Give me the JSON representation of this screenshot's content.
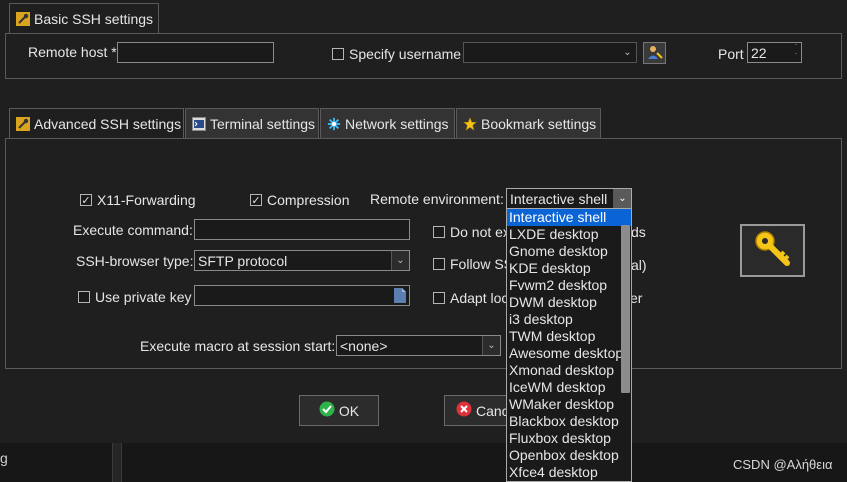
{
  "basic": {
    "tab_label": "Basic SSH settings",
    "remote_host_label": "Remote host *",
    "remote_host_value": "",
    "specify_username_label": "Specify username",
    "username_value": "",
    "port_label": "Port",
    "port_value": "22"
  },
  "tabs": [
    {
      "label": "Advanced SSH settings",
      "icon": "wrench-icon"
    },
    {
      "label": "Terminal settings",
      "icon": "terminal-icon"
    },
    {
      "label": "Network settings",
      "icon": "network-icon"
    },
    {
      "label": "Bookmark settings",
      "icon": "star-icon"
    }
  ],
  "advanced": {
    "x11_label": "X11-Forwarding",
    "x11_checked": true,
    "compression_label": "Compression",
    "compression_checked": true,
    "remote_env_label": "Remote environment:",
    "remote_env_value": "Interactive shell",
    "execute_command_label": "Execute command:",
    "execute_command_value": "",
    "do_not_exit_label_left": "Do not ex",
    "do_not_exit_label_right": "ds",
    "ssh_browser_label": "SSH-browser type:",
    "ssh_browser_value": "SFTP protocol",
    "follow_label_left": "Follow SS",
    "follow_label_right": "al)",
    "use_private_key_label": "Use private key",
    "private_key_value": "",
    "adapt_label_left": "Adapt loc",
    "adapt_label_right": "er",
    "macro_label": "Execute macro at session start:",
    "macro_value": "<none>"
  },
  "dropdown": {
    "items": [
      "Interactive shell",
      "LXDE desktop",
      "Gnome desktop",
      "KDE desktop",
      "Fvwm2 desktop",
      "DWM desktop",
      "i3 desktop",
      "TWM desktop",
      "Awesome desktop",
      "Xmonad desktop",
      "IceWM desktop",
      "WMaker desktop",
      "Blackbox desktop",
      "Fluxbox desktop",
      "Openbox desktop",
      "Xfce4 desktop"
    ],
    "selected_index": 0
  },
  "buttons": {
    "ok_label": "OK",
    "cancel_label": "Cance"
  },
  "footer": {
    "left_text": "g",
    "watermark": "CSDN @Αλήθεια"
  },
  "colors": {
    "background": "#1f1f1f",
    "selection": "#0a64d6",
    "key_gold": "#f5c518"
  }
}
